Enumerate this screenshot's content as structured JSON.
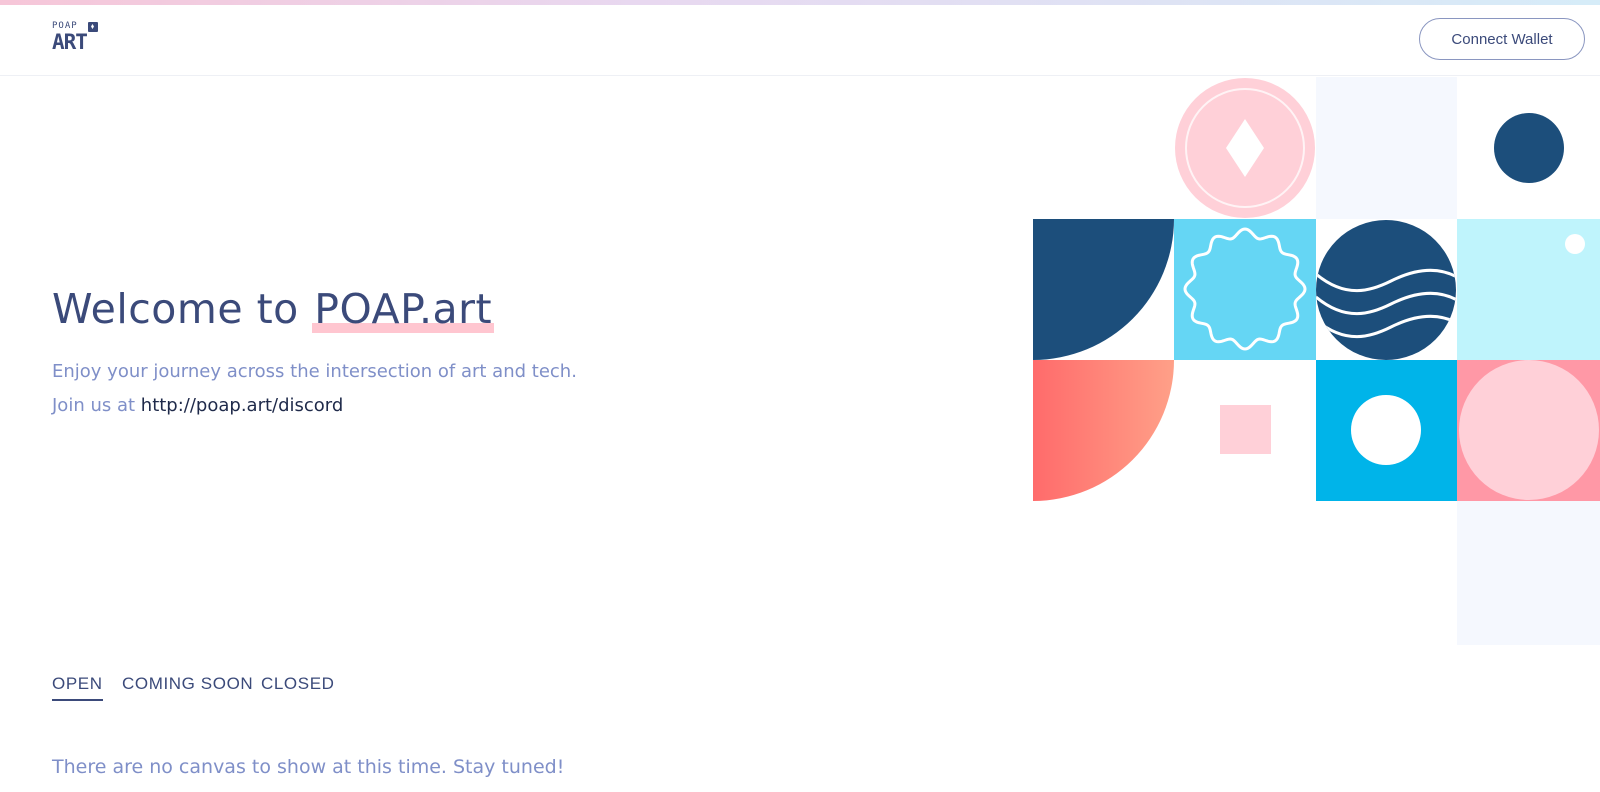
{
  "header": {
    "logo_small": "POAP",
    "logo_big": "ART",
    "connect_label": "Connect Wallet"
  },
  "hero": {
    "title_prefix": "Welcome to ",
    "title_highlight": "POAP.art",
    "tagline": "Enjoy your journey across the intersection of art and tech.",
    "join_prefix": "Join us at ",
    "join_link": "http://poap.art/discord"
  },
  "tabs": [
    {
      "label": "OPEN",
      "active": true
    },
    {
      "label": "COMING SOON",
      "active": false
    },
    {
      "label": "CLOSED",
      "active": false
    }
  ],
  "empty_message": "There are no canvas to show at this time. Stay tuned!",
  "colors": {
    "primary_text": "#3b4a7a",
    "secondary_text": "#7f8fc8",
    "highlight": "#ffc6d0",
    "navy": "#1c4e7b",
    "sky": "#65d6f4",
    "bright_blue": "#00b4e9",
    "light_cyan": "#bff4fc",
    "pink": "#ffd0d8",
    "coral": "#ff6b6b",
    "pale_blue": "#f5f8fe"
  }
}
